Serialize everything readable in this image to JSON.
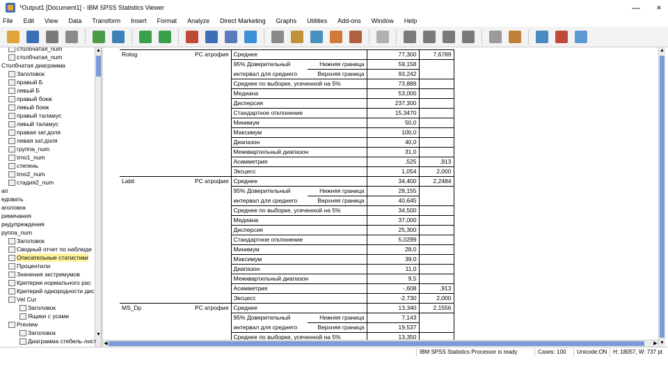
{
  "window": {
    "title": "*Output1 [Document1] - IBM SPSS Statistics Viewer",
    "minimize": "—",
    "close": "×"
  },
  "menu": [
    "File",
    "Edit",
    "View",
    "Data",
    "Transform",
    "Insert",
    "Format",
    "Analyze",
    "Direct Marketing",
    "Graphs",
    "Utilities",
    "Add-ons",
    "Window",
    "Help"
  ],
  "toolbar": {
    "buttons": [
      {
        "icon": "open-folder-icon",
        "color": "#e0a43a"
      },
      {
        "icon": "save-icon",
        "color": "#3d6fb6"
      },
      {
        "icon": "print-icon",
        "color": "#7a7a7a"
      },
      {
        "icon": "print-preview-icon",
        "color": "#8a8a8a"
      },
      {
        "icon": "export-icon",
        "color": "#4a9a4a"
      },
      {
        "icon": "goto-data-icon",
        "color": "#3d7fb6"
      },
      {
        "icon": "undo-icon",
        "color": "#3aa04a"
      },
      {
        "icon": "redo-icon",
        "color": "#3aa04a"
      },
      {
        "icon": "goto-case-icon",
        "color": "#c04a3a"
      },
      {
        "icon": "goto-variable-icon",
        "color": "#3d6fb6"
      },
      {
        "icon": "variables-icon",
        "color": "#5a7ac0"
      },
      {
        "icon": "use-sets-icon",
        "color": "#3d8fd6"
      },
      {
        "icon": "show-all-icon",
        "color": "#8a8a8a"
      },
      {
        "icon": "designate-window-icon",
        "color": "#c0903a"
      },
      {
        "icon": "split-file-icon",
        "color": "#4a90c0"
      },
      {
        "icon": "weight-cases-icon",
        "color": "#d07a3a"
      },
      {
        "icon": "select-cases-icon",
        "color": "#b0603a"
      },
      {
        "icon": "disabled-icon",
        "color": "#b0b0b0"
      },
      {
        "icon": "promote-icon",
        "color": "#7a7a7a"
      },
      {
        "icon": "demote-icon",
        "color": "#7a7a7a"
      },
      {
        "icon": "expand-icon",
        "color": "#7a7a7a"
      },
      {
        "icon": "collapse-icon",
        "color": "#7a7a7a"
      },
      {
        "icon": "hide-icon",
        "color": "#9a9a9a"
      },
      {
        "icon": "show-icon",
        "color": "#c0803a"
      },
      {
        "icon": "insert-heading-icon",
        "color": "#4a8ac0"
      },
      {
        "icon": "insert-title-icon",
        "color": "#c04a3a"
      },
      {
        "icon": "insert-text-icon",
        "color": "#5a9ad0"
      }
    ]
  },
  "outline": {
    "items": [
      {
        "label": "столбчатая_num",
        "indent": 10,
        "icon": "table-icon"
      },
      {
        "label": "столбчатая_num",
        "indent": 10,
        "icon": "table-icon"
      },
      {
        "label": "Столбчатая диаграмма",
        "indent": 0,
        "icon": "none"
      },
      {
        "label": "Заголовок",
        "indent": 10,
        "icon": "title-icon"
      },
      {
        "label": "правый Б",
        "indent": 10,
        "icon": "table-icon"
      },
      {
        "label": "левый Б",
        "indent": 10,
        "icon": "table-icon"
      },
      {
        "label": "правый бокж",
        "indent": 10,
        "icon": "table-icon"
      },
      {
        "label": "левый бокж",
        "indent": 10,
        "icon": "table-icon"
      },
      {
        "label": "правый таламус",
        "indent": 10,
        "icon": "table-icon"
      },
      {
        "label": "левый таламус",
        "indent": 10,
        "icon": "table-icon"
      },
      {
        "label": "правая зат.доля",
        "indent": 10,
        "icon": "table-icon"
      },
      {
        "label": "левая зат.доля",
        "indent": 10,
        "icon": "table-icon"
      },
      {
        "label": "группа_num",
        "indent": 10,
        "icon": "table-icon"
      },
      {
        "label": "trno1_num",
        "indent": 10,
        "icon": "table-icon"
      },
      {
        "label": "степень",
        "indent": 10,
        "icon": "table-icon"
      },
      {
        "label": "trno2_num",
        "indent": 10,
        "icon": "table-icon"
      },
      {
        "label": "стадия2_num",
        "indent": 10,
        "icon": "table-icon"
      },
      {
        "label": "ап",
        "indent": 0,
        "icon": "none"
      },
      {
        "label": "едовать",
        "indent": 0,
        "icon": "none"
      },
      {
        "label": "аголовок",
        "indent": 0,
        "icon": "none"
      },
      {
        "label": "римечания",
        "indent": 0,
        "icon": "none"
      },
      {
        "label": "редупреждения",
        "indent": 0,
        "icon": "none"
      },
      {
        "label": "руппа_num",
        "indent": 0,
        "icon": "none"
      },
      {
        "label": "Заголовок",
        "indent": 10,
        "icon": "title-icon"
      },
      {
        "label": "Сводный отчет по наблюде",
        "indent": 10,
        "icon": "table-icon"
      },
      {
        "label": "Описательные статистики",
        "indent": 10,
        "icon": "table-icon",
        "selected": true
      },
      {
        "label": "Процентили",
        "indent": 10,
        "icon": "table-icon"
      },
      {
        "label": "Значения экстремумов",
        "indent": 10,
        "icon": "table-icon"
      },
      {
        "label": "Критерии нормального рас",
        "indent": 10,
        "icon": "table-icon"
      },
      {
        "label": "Критерий однородности дис",
        "indent": 10,
        "icon": "table-icon"
      },
      {
        "label": "Vet Cur",
        "indent": 10,
        "icon": "folder-icon"
      },
      {
        "label": "Заголовок",
        "indent": 26,
        "icon": "title-icon"
      },
      {
        "label": "Ящики с усами",
        "indent": 26,
        "icon": "chart-icon"
      },
      {
        "label": "Preview",
        "indent": 10,
        "icon": "folder-icon"
      },
      {
        "label": "Заголовок",
        "indent": 26,
        "icon": "title-icon"
      },
      {
        "label": "Диаграмма стебель-лист",
        "indent": 26,
        "icon": "table-icon"
      }
    ]
  },
  "table": {
    "groups": [
      {
        "variable": "Rolog",
        "group": "РС атрофия",
        "rows": [
          {
            "stat": "Среднее",
            "sub": "",
            "value": "77,300",
            "err": "7,6789"
          },
          {
            "stat": "95% Доверительный",
            "sub": "Нижняя граница",
            "value": "59,158",
            "err": ""
          },
          {
            "stat": "интервал для среднего",
            "sub": "Верхняя граница",
            "value": "93,242",
            "err": ""
          },
          {
            "stat": "Среднее по выборке, усеченной на 5%",
            "sub": "",
            "value": "73,889",
            "err": ""
          },
          {
            "stat": "Медиана",
            "sub": "",
            "value": "53,000",
            "err": ""
          },
          {
            "stat": "Дисперсия",
            "sub": "",
            "value": "237,300",
            "err": ""
          },
          {
            "stat": "Стандартное отклонение",
            "sub": "",
            "value": "15,3470",
            "err": ""
          },
          {
            "stat": "Минимум",
            "sub": "",
            "value": "50,0",
            "err": ""
          },
          {
            "stat": "Максимум",
            "sub": "",
            "value": "100,0",
            "err": ""
          },
          {
            "stat": "Диапазон",
            "sub": "",
            "value": "40,0",
            "err": ""
          },
          {
            "stat": "Межквартильный диапазон",
            "sub": "",
            "value": "31,0",
            "err": ""
          },
          {
            "stat": "Асимметрия",
            "sub": "",
            "value": ",525",
            "err": ",913"
          },
          {
            "stat": "Эксцесс",
            "sub": "",
            "value": "1,054",
            "err": "2,000"
          }
        ]
      },
      {
        "variable": "Labil",
        "group": "РС атрофия",
        "rows": [
          {
            "stat": "Среднее",
            "sub": "",
            "value": "34,400",
            "err": "2,2484"
          },
          {
            "stat": "95% Доверительный",
            "sub": "Нижняя граница",
            "value": "28,155",
            "err": ""
          },
          {
            "stat": "интервал для среднего",
            "sub": "Верхняя граница",
            "value": "40,645",
            "err": ""
          },
          {
            "stat": "Среднее по выборке, усеченной на 5%",
            "sub": "",
            "value": "34,500",
            "err": ""
          },
          {
            "stat": "Медиана",
            "sub": "",
            "value": "37,000",
            "err": ""
          },
          {
            "stat": "Дисперсия",
            "sub": "",
            "value": "25,300",
            "err": ""
          },
          {
            "stat": "Стандартное отклонение",
            "sub": "",
            "value": "5,0299",
            "err": ""
          },
          {
            "stat": "Минимум",
            "sub": "",
            "value": "28,0",
            "err": ""
          },
          {
            "stat": "Максимум",
            "sub": "",
            "value": "39,0",
            "err": ""
          },
          {
            "stat": "Диапазон",
            "sub": "",
            "value": "11,0",
            "err": ""
          },
          {
            "stat": "Межквартильный диапазон",
            "sub": "",
            "value": "9,5",
            "err": ""
          },
          {
            "stat": "Асимметрия",
            "sub": "",
            "value": "-,608",
            "err": ",913"
          },
          {
            "stat": "Эксцесс",
            "sub": "",
            "value": "-2,730",
            "err": "2,000"
          }
        ]
      },
      {
        "variable": "MS_Dp",
        "group": "РС атрофия",
        "rows": [
          {
            "stat": "Среднее",
            "sub": "",
            "value": "13,340",
            "err": "2,1556"
          },
          {
            "stat": "95% Доверительный",
            "sub": "Нижняя граница",
            "value": "7,143",
            "err": ""
          },
          {
            "stat": "интервал для среднего",
            "sub": "Верхняя граница",
            "value": "19,537",
            "err": ""
          },
          {
            "stat": "Среднее по выборке, усеченной на 5%",
            "sub": "",
            "value": "13,350",
            "err": ""
          }
        ]
      }
    ]
  },
  "status": {
    "processor": "IBM SPSS Statistics Processor is ready",
    "cases": "Cases: 100",
    "unicode": "Unicode:ON",
    "height": "H: 18057, W: 737 pt"
  }
}
